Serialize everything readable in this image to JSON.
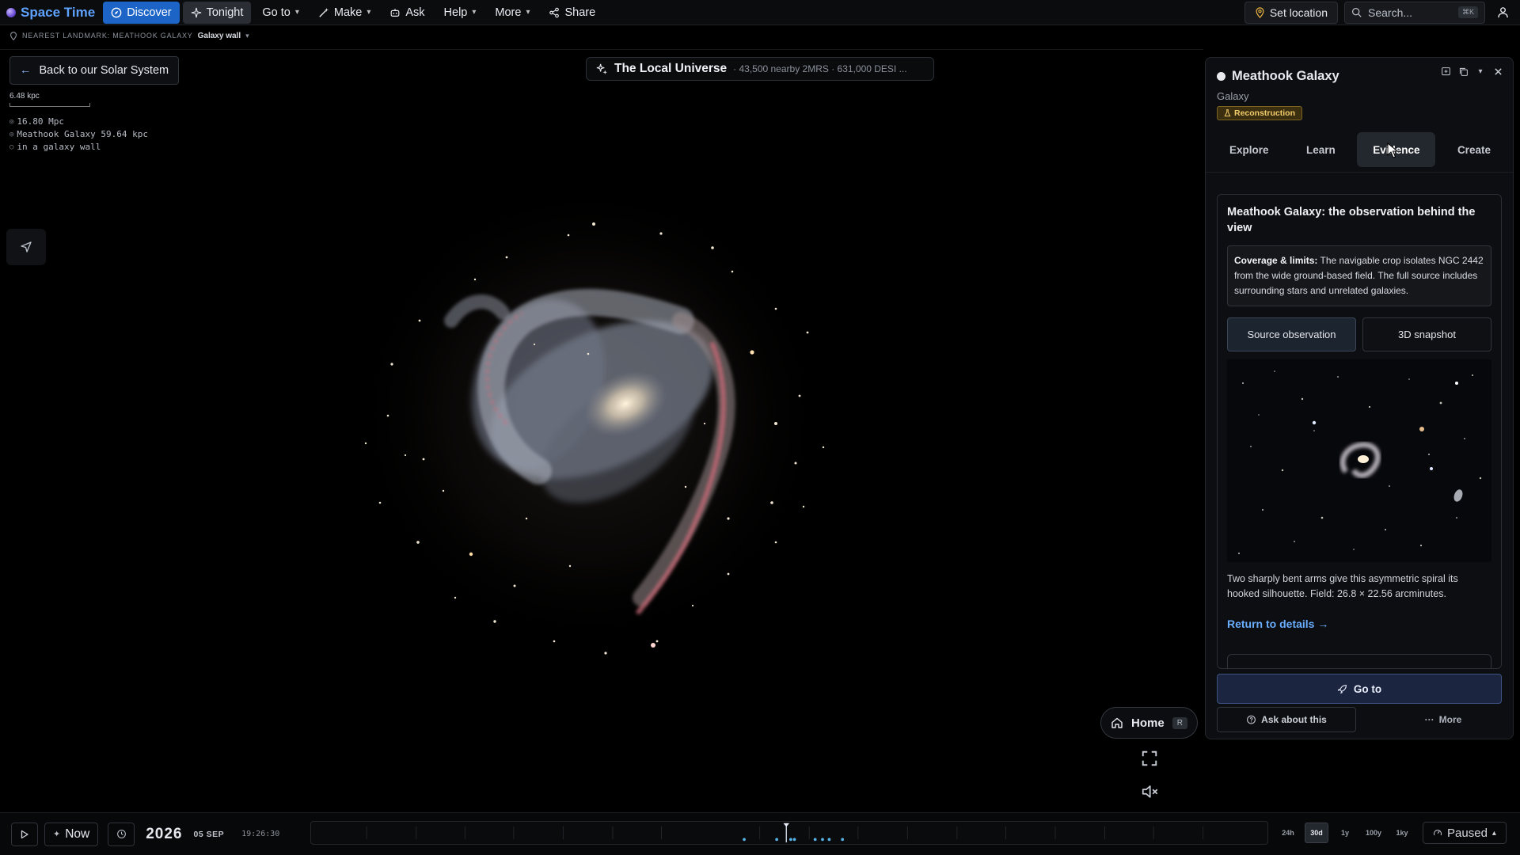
{
  "app": {
    "name": "Space Time"
  },
  "nav": {
    "discover": "Discover",
    "tonight": "Tonight",
    "goto": "Go to",
    "make": "Make",
    "ask": "Ask",
    "help": "Help",
    "more": "More",
    "share": "Share"
  },
  "topright": {
    "set_location": "Set location",
    "search_placeholder": "Search...",
    "search_kbd": "⌘K"
  },
  "landmark": {
    "label": "NEAREST LANDMARK: MEATHOOK GALAXY",
    "value": "Galaxy wall"
  },
  "left": {
    "back_label": "Back to our Solar System",
    "scale_label": "6.48 kpc",
    "coords": [
      "16.80 Mpc",
      "Meathook Galaxy 59.64 kpc",
      "in a galaxy wall"
    ]
  },
  "center": {
    "title": "The Local Universe",
    "subtitle": "· 43,500 nearby 2MRS · 631,000 DESI ..."
  },
  "controls": {
    "home_label": "Home",
    "home_kbd": "R"
  },
  "panel": {
    "title": "Meathook Galaxy",
    "type": "Galaxy",
    "badge": "Reconstruction",
    "tabs": [
      "Explore",
      "Learn",
      "Evidence",
      "Create"
    ],
    "active_tab": "Evidence",
    "card": {
      "title": "Meathook Galaxy: the observation behind the view",
      "limits_label": "Coverage & limits:",
      "limits_text": "The navigable crop isolates NGC 2442 from the wide ground-based field. The full source includes surrounding stars and unrelated galaxies.",
      "btn_source": "Source observation",
      "btn_snapshot": "3D snapshot",
      "caption": "Two sharply bent arms give this asymmetric spiral its hooked silhouette. Field: 26.8 × 22.56 arcminutes.",
      "return_link": "Return to details →"
    },
    "go_label": "Go to",
    "ask_label": "Ask about this",
    "more_label": "More"
  },
  "timeline": {
    "now_label": "Now",
    "year": "2026",
    "date": "05 SEP",
    "time": "19:26:30",
    "ranges": [
      "24h",
      "30d",
      "1y",
      "100y",
      "1ky"
    ],
    "active_range": "30d",
    "status": "Paused"
  },
  "colors": {
    "accent": "#1d64c7",
    "brand": "#5ea2ff",
    "badge": "#f2cc6a",
    "link": "#6aaeff"
  }
}
